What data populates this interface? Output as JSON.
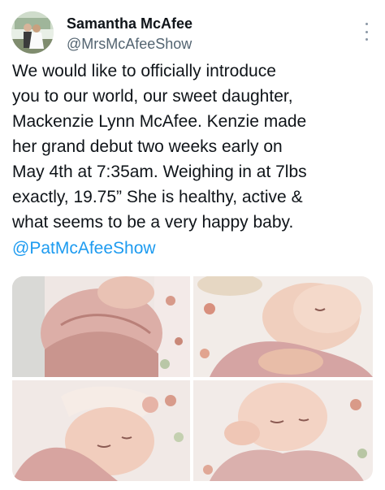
{
  "author": {
    "display_name": "Samantha McAfee",
    "handle": "@MrsMcAfeeShow",
    "avatar_icon": "profile-photo"
  },
  "tweet": {
    "text": "We would like to officially introduce\nyou to our world, our sweet daughter,\nMackenzie Lynn McAfee. Kenzie made\nher grand debut two weeks early on\nMay 4th at 7:35am. Weighing in at 7lbs\nexactly, 19.75” She is healthy, active &\nwhat seems to be a very happy baby.",
    "mention": "@PatMcAfeeShow"
  },
  "media": {
    "photos": [
      {
        "alt": "newborn-swaddled-pink-blanket"
      },
      {
        "alt": "newborn-sleeping-hand-on-chest"
      },
      {
        "alt": "newborn-with-flower-headband"
      },
      {
        "alt": "newborn-smiling-in-pink"
      }
    ]
  },
  "colors": {
    "text": "#0f1419",
    "secondary": "#536471",
    "link": "#1d9bf0"
  },
  "icons": {
    "more": "more-options-icon"
  }
}
